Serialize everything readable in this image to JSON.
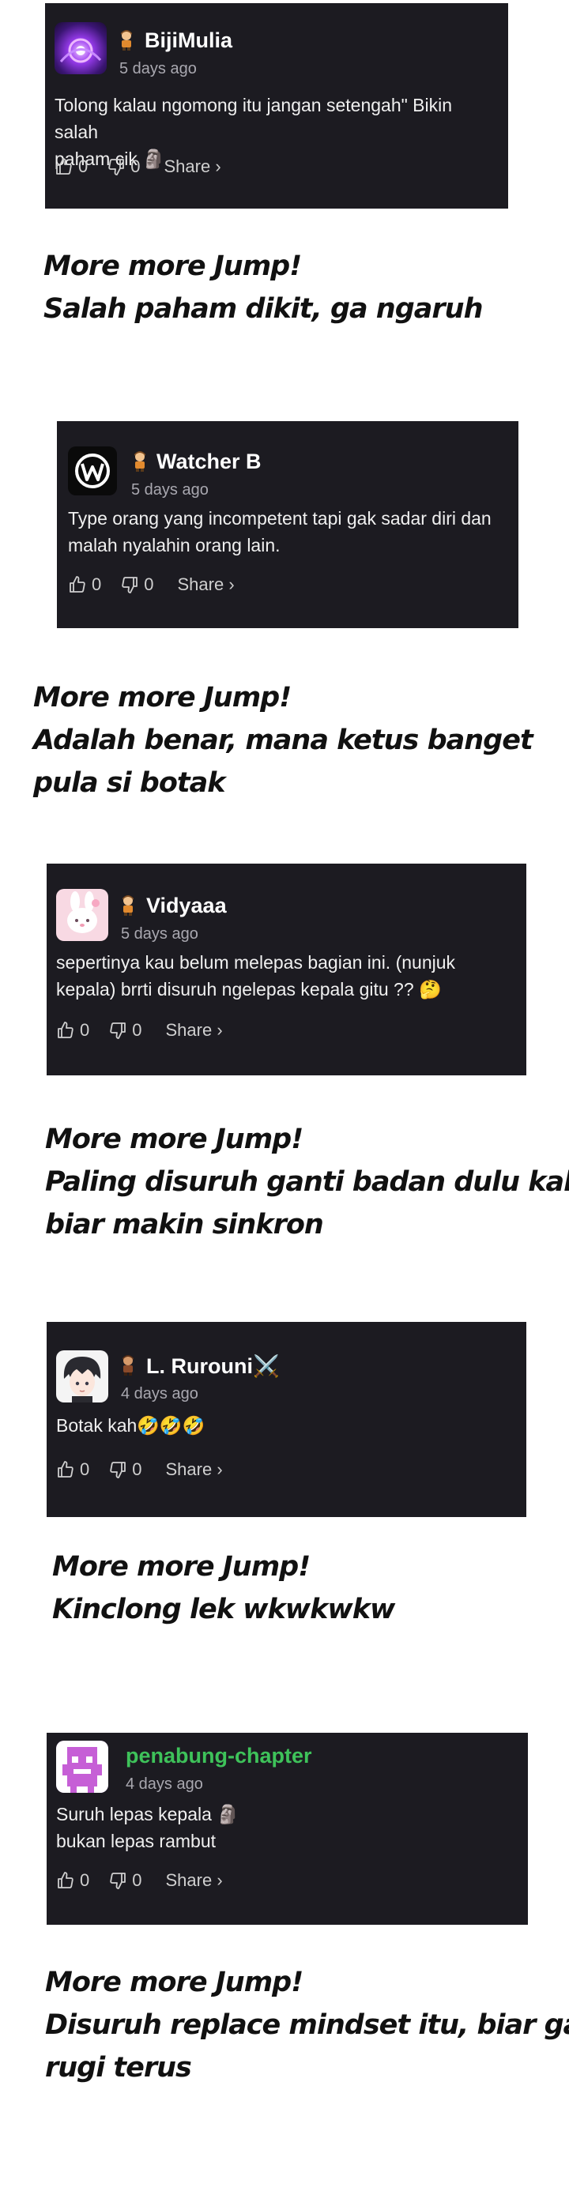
{
  "comments": [
    {
      "username": "BijiMulia",
      "rank_icon": "character-badge-icon",
      "time": "5 days ago",
      "lines": [
        "Tolong kalau ngomong itu jangan setengah\" Bikin salah",
        "paham cik 🗿"
      ],
      "likes": "0",
      "dislikes": "0",
      "share": "Share ›",
      "avatar_icon": "purple-swirl-avatar",
      "reply_lines": [
        "More more Jump!",
        "Salah paham dikit, ga ngaruh"
      ]
    },
    {
      "username": "Watcher B",
      "rank_icon": "character-badge-icon",
      "time": "5 days ago",
      "lines": [
        "Type orang yang incompetent tapi gak sadar diri dan",
        "malah nyalahin orang lain."
      ],
      "likes": "0",
      "dislikes": "0",
      "share": "Share ›",
      "avatar_icon": "wb-logo-avatar",
      "reply_lines": [
        "More more Jump!",
        "Adalah benar, mana ketus banget",
        "pula si botak"
      ]
    },
    {
      "username": "Vidyaaa",
      "rank_icon": "character-badge-icon",
      "time": "5 days ago",
      "lines": [
        "sepertinya kau belum melepas bagian ini. (nunjuk",
        "kepala) brrti disuruh ngelepas kepala gitu ?? 🤔"
      ],
      "likes": "0",
      "dislikes": "0",
      "share": "Share ›",
      "avatar_icon": "pink-bunny-avatar",
      "reply_lines": [
        "More more Jump!",
        "Paling disuruh ganti badan dulu kak,",
        "biar makin sinkron"
      ]
    },
    {
      "username": "L. Rurouni⚔️",
      "rank_icon": "character-badge-icon",
      "time": "4 days ago",
      "lines": [
        "Botak kah🤣🤣🤣"
      ],
      "likes": "0",
      "dislikes": "0",
      "share": "Share ›",
      "avatar_icon": "anime-boy-avatar",
      "reply_lines": [
        "More more Jump!",
        "Kinclong lek wkwkwkw"
      ]
    },
    {
      "username": "penabung-chapter",
      "rank_icon": "",
      "time": "4 days ago",
      "lines": [
        "Suruh lepas kepala 🗿",
        "bukan lepas rambut"
      ],
      "likes": "0",
      "dislikes": "0",
      "share": "Share ›",
      "avatar_icon": "pixel-invader-avatar",
      "reply_lines": [
        "More more Jump!",
        "Disuruh replace mindset itu, biar ga",
        "rugi terus"
      ]
    }
  ]
}
